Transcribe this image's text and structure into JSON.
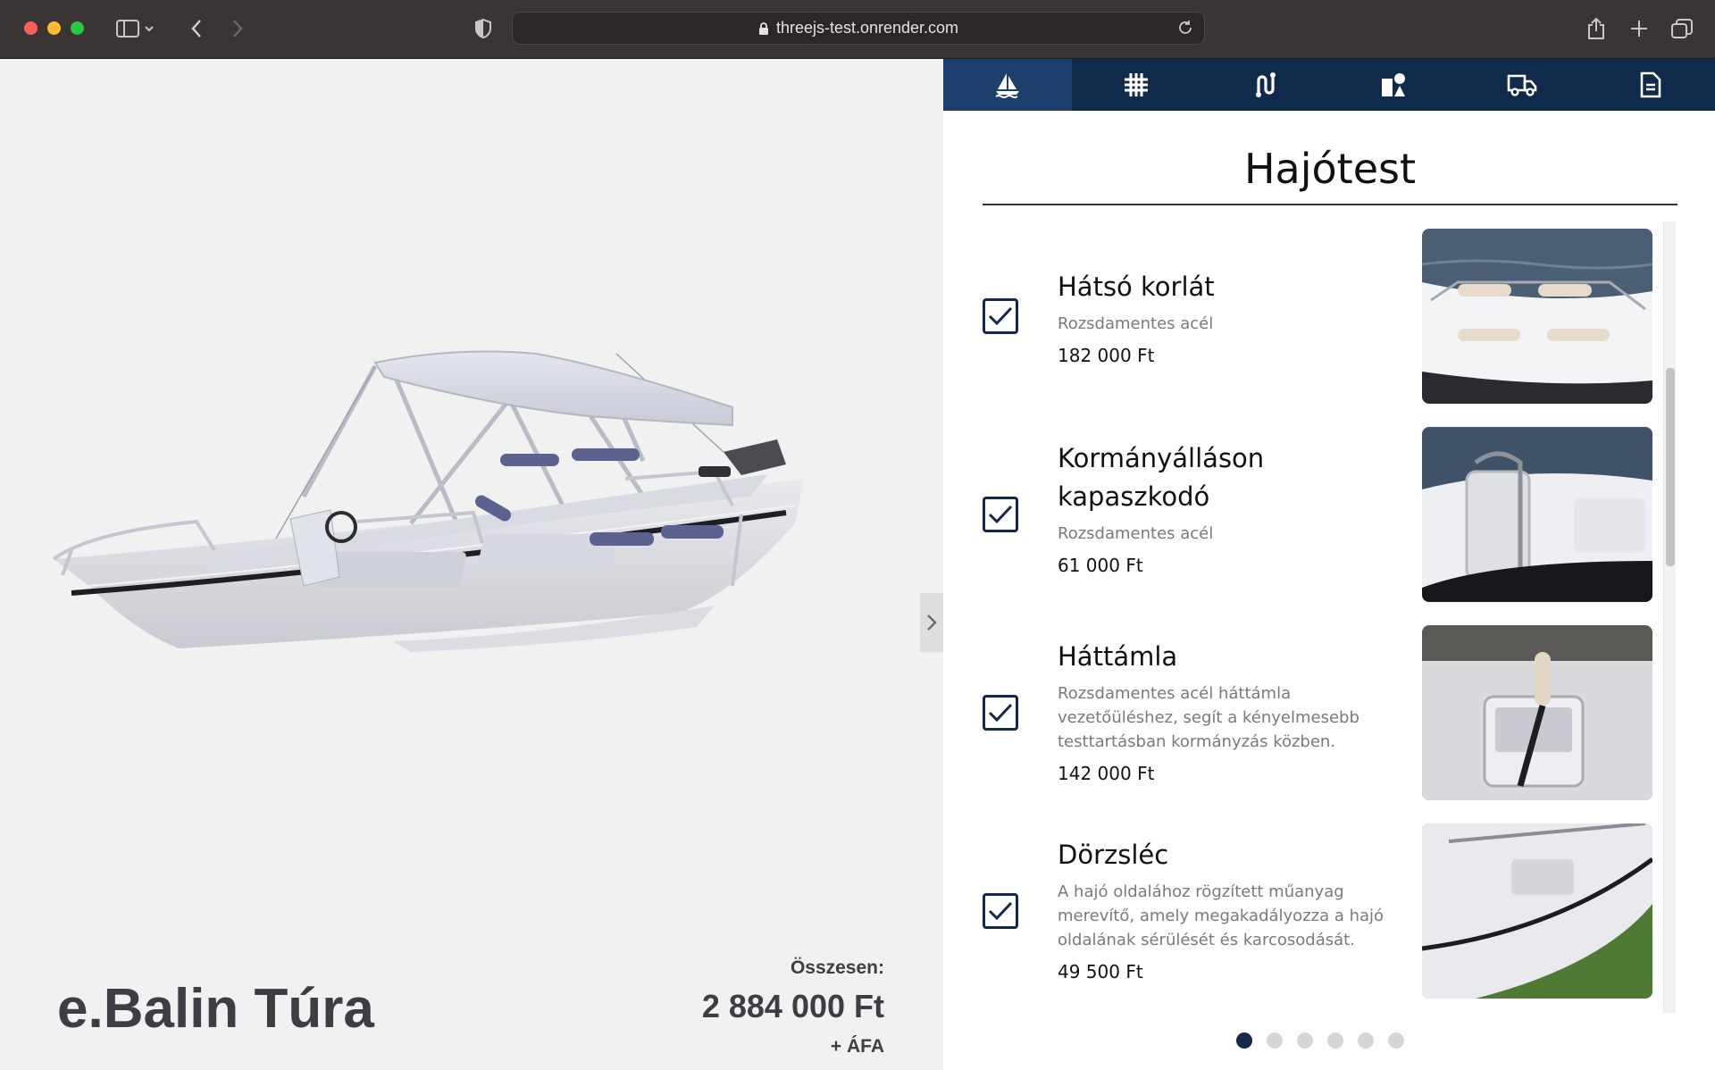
{
  "browser": {
    "url": "threejs-test.onrender.com"
  },
  "viewer": {
    "product_name": "e.Balin Túra",
    "total_label": "Összesen:",
    "total_value": "2 884 000 Ft",
    "vat_label": "+ ÁFA"
  },
  "tabs": [
    {
      "icon": "sailboat-icon",
      "active": true
    },
    {
      "icon": "grid-hash-icon",
      "active": false
    },
    {
      "icon": "route-icon",
      "active": false
    },
    {
      "icon": "shapes-icon",
      "active": false
    },
    {
      "icon": "truck-icon",
      "active": false
    },
    {
      "icon": "document-icon",
      "active": false
    }
  ],
  "section": {
    "title": "Hajótest"
  },
  "items": [
    {
      "title": "Hátsó korlát",
      "description": "Rozsdamentes acél",
      "price": "182 000 Ft",
      "checked": true
    },
    {
      "title": "Kormányálláson kapaszkodó",
      "description": "Rozsdamentes acél",
      "price": "61 000 Ft",
      "checked": true
    },
    {
      "title": "Háttámla",
      "description": "Rozsdamentes acél háttámla vezetőüléshez, segít a kényelmesebb testtartásban kormányzás közben.",
      "price": "142 000 Ft",
      "checked": true
    },
    {
      "title": "Dörzsléc",
      "description": "A hajó oldalához rögzített műanyag merevítő, amely megakadályozza a hajó oldalának sérülését és karcosodását.",
      "price": "49 500 Ft",
      "checked": true
    }
  ],
  "pagination": {
    "total": 6,
    "current": 1
  },
  "colors": {
    "navy": "#102a4c",
    "navy_active": "#1d3f6e",
    "text_dark": "#3c3e44"
  }
}
